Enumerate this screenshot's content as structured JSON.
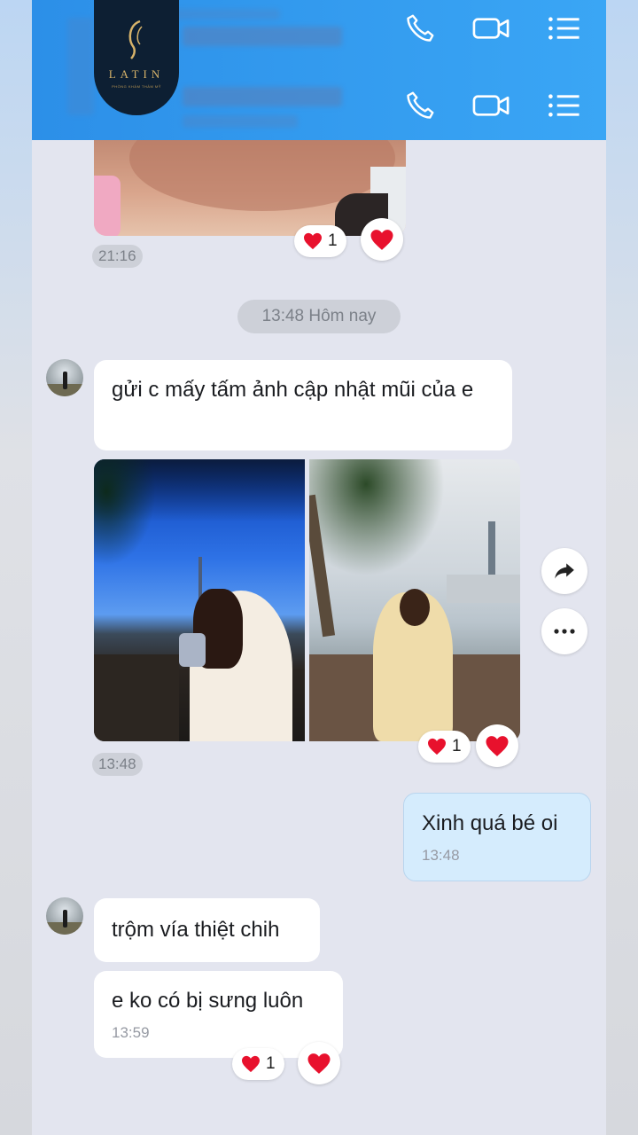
{
  "header": {
    "logo_text": "LATIN",
    "logo_subtext": "PHÒNG KHÁM THẨM MỸ",
    "contacts": [
      {
        "name_blurred": "",
        "actions": [
          "phone-icon",
          "video-call-icon",
          "menu-list-icon"
        ]
      },
      {
        "name_blurred": "",
        "actions": [
          "phone-icon",
          "video-call-icon",
          "menu-list-icon"
        ]
      }
    ]
  },
  "earlier": {
    "time": "21:16",
    "reaction_count": "1"
  },
  "date_divider": "13:48 Hôm nay",
  "messages": {
    "m1_text": "gửi c mấy tấm ảnh cập nhật mũi của e",
    "images_time": "13:48",
    "images_reaction_count": "1",
    "reply_text": "Xinh quá bé oi",
    "reply_time": "13:48",
    "m2_text": "trộm vía thiệt chih",
    "m3_text": "e ko có bị sưng luôn",
    "m3_time": "13:59",
    "m3_reaction_count": "1"
  },
  "colors": {
    "header_blue": "#3aa6f5",
    "chat_bg": "#e3e5ef",
    "my_bubble": "#d5ecfd",
    "heart_red": "#e8112d"
  }
}
